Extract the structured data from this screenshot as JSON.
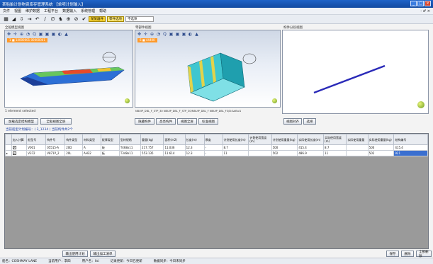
{
  "window": {
    "title": "某船舶计划物资库存管理系统  【单项计划输入】",
    "buttons": [
      "_",
      "□",
      "×"
    ]
  },
  "menu": {
    "items": [
      "文件",
      "视图",
      "维护数据",
      "工程平台",
      "数据输入",
      "系统管理",
      "帮助"
    ],
    "right_controls": "- ♂ ×"
  },
  "toolbar": {
    "icons": [
      "▦",
      "◢",
      "⇩",
      "⇥",
      "↶",
      "∕",
      "∅",
      "♞",
      "⊕",
      "⊘",
      "✔"
    ],
    "btn_yellow1": "某某器件",
    "btn_yellow2": "零件选项",
    "dropdown_value": "不选项"
  },
  "panes": {
    "left_label": "全船模型视图",
    "middle_label": "零部件视图",
    "right_label": "构件分段视图",
    "left_tag": "1 ■ 14000001 00000001",
    "middle_tag": "6 ■ 44400",
    "left_status": "1 element selected",
    "middle_status": "NBUIP_DBL_F_STP_30  NBUIP_DBL_F_STP_30/NBUIP_DBL_F  NBUIP_DBL_F3/D:&dBul1"
  },
  "view_tools": [
    "✥",
    "✛",
    "⊕",
    "◔",
    "Q",
    "▣",
    "▣",
    "▣",
    "◐",
    "▲"
  ],
  "buttons_row": {
    "left_a": "加载选定结构模型",
    "left_b": "全船视图全屏",
    "mid_a": "隐藏构件",
    "mid_b": "高亮构件",
    "mid_c": "视图全屏",
    "mid_d": "标准视图",
    "right_a": "视图对齐",
    "right_b": "选择"
  },
  "info_line": "当前船型计划编号：( 3_1234 ) 当前构件共2个",
  "table": {
    "headers": [
      "",
      "加入计算",
      "船型号",
      "构件号",
      "构件类型",
      "材料类型",
      "板厚类型",
      "型材规格",
      "重量(kg)",
      "面积(m2)",
      "长度(m)",
      "厚度",
      "计划使用长度(m)",
      "计划使用宽度(m)",
      "计划使用重量(kg)",
      "实际使用长度(m)",
      "实际使用宽度(m)",
      "实际使用重量",
      "实际使用重量(kg)",
      "结构编号"
    ],
    "rows": [
      {
        "marker": "",
        "check": "✓",
        "ship": "V001",
        "part": "05515-A",
        "ptype": "20D",
        "mtype": "A",
        "thick": "板",
        "spec": "T468x11",
        "weight": "217.757",
        "area": "11.036",
        "length": "12.3",
        "t": "-",
        "pl": "8.7",
        "pw": "",
        "pwt": "500",
        "al": "415.4",
        "aw": "8.7",
        "awt": "",
        "aw2": "500",
        "awt2": "415.4",
        "code": ""
      },
      {
        "marker": "▸",
        "check": "✓",
        "ship": "V372",
        "part": "V871P_2",
        "ptype": "20L",
        "mtype": "AH32",
        "thick": "板",
        "spec": "T348x11",
        "weight": "553.135",
        "area": "11.614",
        "length": "12.3",
        "t": "-",
        "pl": "11",
        "pw": "",
        "pwt": "502",
        "al": "486.9",
        "aw": "11",
        "awt": "",
        "aw2": "502",
        "awt2": "486.9",
        "code": "921"
      }
    ]
  },
  "bottom_buttons": {
    "plan_export": "输出使用计划",
    "export_sheet": "输出加工清单",
    "save": "保存",
    "delete": "删除",
    "delete_all": "全部删除"
  },
  "statusbar": {
    "ship": "船名：COSHMAY LANE",
    "user": "当前用户：李四",
    "unit": "用户名：lisi",
    "record": "记录更新：今日已更新",
    "sync": "数据同步：今日未同步"
  }
}
